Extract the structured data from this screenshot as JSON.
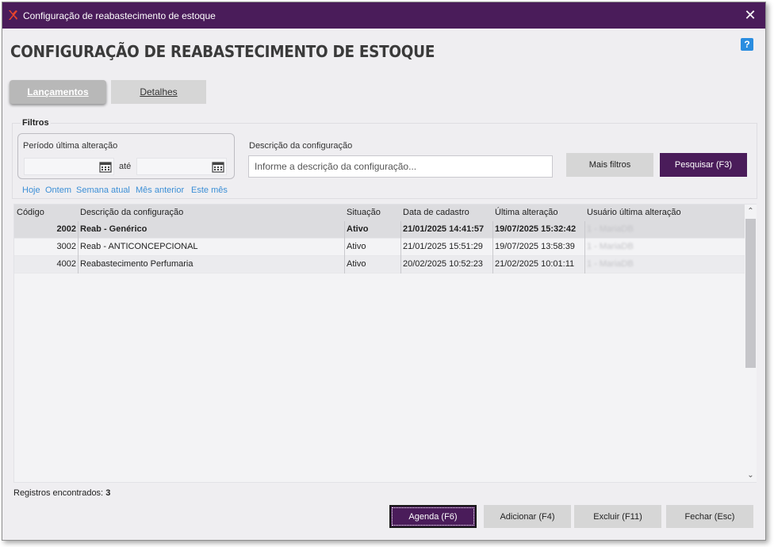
{
  "window": {
    "title": "Configuração de reabastecimento de estoque",
    "close_label": "✕"
  },
  "page": {
    "title": "CONFIGURAÇÃO DE REABASTECIMENTO DE ESTOQUE",
    "help_label": "?"
  },
  "tabs": [
    {
      "label": "Lançamentos",
      "active": true
    },
    {
      "label": "Detalhes",
      "active": false
    }
  ],
  "filters": {
    "title": "Filtros",
    "period_label": "Período última alteração",
    "date_from": "",
    "date_to": "",
    "between_label": "até",
    "quick_links": [
      "Hoje",
      "Ontem",
      "Semana atual",
      "Mês anterior",
      "Este mês"
    ],
    "description_label": "Descrição da configuração",
    "description_placeholder": "Informe a descrição da configuração...",
    "more_filters_label": "Mais filtros",
    "search_label": "Pesquisar (F3)"
  },
  "table": {
    "columns": [
      "Código",
      "Descrição da configuração",
      "Situação",
      "Data de cadastro",
      "Última alteração",
      "Usuário última alteração"
    ],
    "rows": [
      {
        "codigo": "2002",
        "descricao": "Reab - Genérico",
        "situacao": "Ativo",
        "cadastro": "21/01/2025 14:41:57",
        "alteracao": "19/07/2025 15:32:42",
        "usuario": "1 - MariaDB"
      },
      {
        "codigo": "3002",
        "descricao": "Reab - ANTICONCEPCIONAL",
        "situacao": "Ativo",
        "cadastro": "21/01/2025 15:51:29",
        "alteracao": "19/07/2025 13:58:39",
        "usuario": "1 - MariaDB"
      },
      {
        "codigo": "4002",
        "descricao": "Reabastecimento Perfumaria",
        "situacao": "Ativo",
        "cadastro": "20/02/2025 10:52:23",
        "alteracao": "21/02/2025 10:01:11",
        "usuario": "1 - MariaDB"
      }
    ]
  },
  "footer": {
    "records_label": "Registros encontrados:",
    "records_count": "3",
    "buttons": {
      "agenda": "Agenda (F6)",
      "adicionar": "Adicionar (F4)",
      "excluir": "Excluir (F11)",
      "fechar": "Fechar (Esc)"
    }
  },
  "colors": {
    "titlebar": "#4a1c5a",
    "accent_button": "#4a1c5a",
    "link": "#3c8fd6",
    "help": "#2a8de0"
  },
  "icons": [
    "app-logo-icon",
    "close-icon",
    "help-icon",
    "calendar-icon",
    "scroll-up-icon",
    "scroll-down-icon"
  ]
}
